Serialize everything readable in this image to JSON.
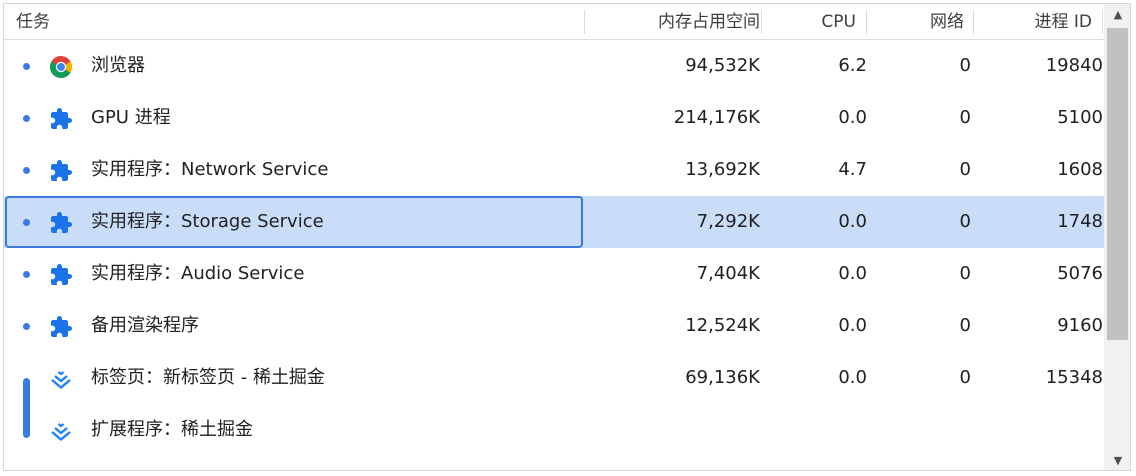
{
  "header": {
    "task": "任务",
    "memory": "内存占用空间",
    "cpu": "CPU",
    "network": "网络",
    "pid": "进程 ID"
  },
  "rows": [
    {
      "name": "浏览器",
      "icon": "chrome-icon",
      "memory": "94,532K",
      "cpu": "6.2",
      "network": "0",
      "pid": "19840"
    },
    {
      "name": "GPU 进程",
      "icon": "puzzle-icon",
      "memory": "214,176K",
      "cpu": "0.0",
      "network": "0",
      "pid": "5100"
    },
    {
      "name": "实用程序：Network Service",
      "icon": "puzzle-icon",
      "memory": "13,692K",
      "cpu": "4.7",
      "network": "0",
      "pid": "1608"
    },
    {
      "name": "实用程序：Storage Service",
      "icon": "puzzle-icon",
      "memory": "7,292K",
      "cpu": "0.0",
      "network": "0",
      "pid": "1748",
      "selected": true
    },
    {
      "name": "实用程序：Audio Service",
      "icon": "puzzle-icon",
      "memory": "7,404K",
      "cpu": "0.0",
      "network": "0",
      "pid": "5076"
    },
    {
      "name": "备用渲染程序",
      "icon": "puzzle-icon",
      "memory": "12,524K",
      "cpu": "0.0",
      "network": "0",
      "pid": "9160"
    },
    {
      "name": "标签页：新标签页 - 稀土掘金",
      "icon": "juejin-icon",
      "memory": "69,136K",
      "cpu": "0.0",
      "network": "0",
      "pid": "15348"
    },
    {
      "name": "扩展程序：稀土掘金",
      "icon": "juejin-icon",
      "memory": "",
      "cpu": "",
      "network": "",
      "pid": ""
    }
  ],
  "scrollbar": {
    "up_glyph": "▲",
    "down_glyph": "▼"
  },
  "colors": {
    "accent": "#3b7be0",
    "selection": "#c9ddf8",
    "focus_border": "#3c78d8"
  }
}
